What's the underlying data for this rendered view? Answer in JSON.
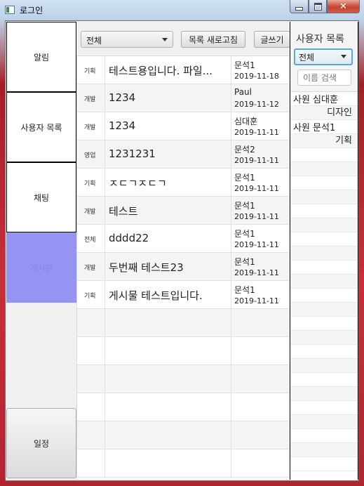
{
  "window": {
    "title": "로그인"
  },
  "nav": {
    "items": [
      {
        "label": "알림"
      },
      {
        "label": "사용자 목록"
      },
      {
        "label": "채팅"
      },
      {
        "label": "게시판"
      }
    ],
    "schedule_label": "일정"
  },
  "toolbar": {
    "category_select": "전체",
    "refresh_label": "목록 새로고침",
    "write_label": "글쓰기"
  },
  "board": {
    "rows": [
      {
        "category": "기획",
        "title": "테스트용입니다. 파일...",
        "author": "문석1",
        "date": "2019-11-18"
      },
      {
        "category": "개발",
        "title": "1234",
        "author": "Paul",
        "date": "2019-11-12"
      },
      {
        "category": "개발",
        "title": "1234",
        "author": "심대훈",
        "date": "2019-11-11"
      },
      {
        "category": "영업",
        "title": "1231231",
        "author": "문석2",
        "date": "2019-11-11"
      },
      {
        "category": "기획",
        "title": "ㅈㄷㄱㅈㄷㄱ",
        "author": "문석1",
        "date": "2019-11-11"
      },
      {
        "category": "개발",
        "title": "테스트",
        "author": "문석1",
        "date": "2019-11-11"
      },
      {
        "category": "전체",
        "title": "dddd22",
        "author": "문석1",
        "date": "2019-11-11"
      },
      {
        "category": "개발",
        "title": "두번째 테스트23",
        "author": "문석1",
        "date": "2019-11-11"
      },
      {
        "category": "기획",
        "title": "게시물 테스트입니다.",
        "author": "문석1",
        "date": "2019-11-11"
      }
    ]
  },
  "users": {
    "title": "사용자 목록",
    "filter": "전체",
    "search_placeholder": "이름 검색",
    "items": [
      {
        "name": "사원 심대훈",
        "dept": "디자인"
      },
      {
        "name": "사원 문석1",
        "dept": "기획"
      }
    ]
  }
}
